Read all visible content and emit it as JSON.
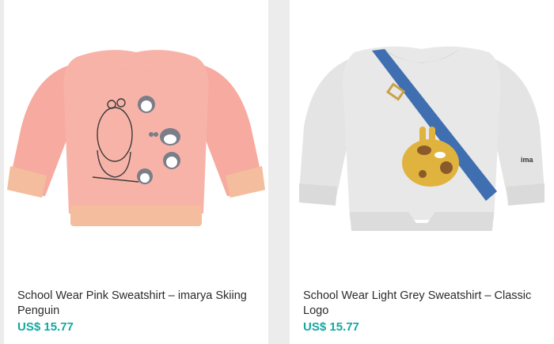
{
  "products": [
    {
      "title": "School Wear Pink Sweatshirt – imarya Skiing Penguin",
      "price": "US$ 15.77",
      "image": "pink sweatshirt with bear and penguins print",
      "color": "#f7aaa0"
    },
    {
      "title": "School Wear Light Grey Sweatshirt – Classic Logo",
      "price": "US$ 15.77",
      "image": "light grey sweatshirt with giraffe and blue strap print",
      "color": "#e3e3e3"
    }
  ],
  "colors": {
    "price": "#13a8a0",
    "background": "#ececec"
  }
}
